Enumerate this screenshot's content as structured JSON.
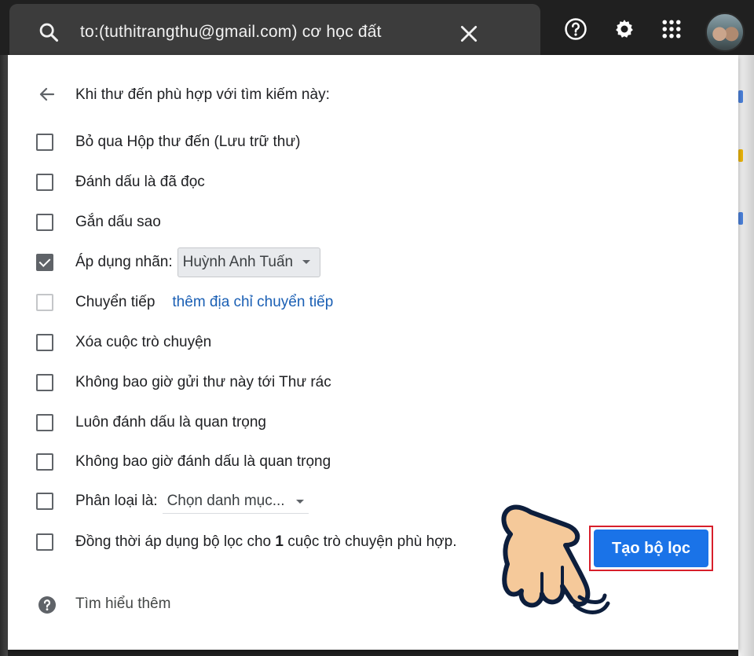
{
  "search": {
    "query": "to:(tuthitrangthu@gmail.com) cơ học đất",
    "icon": "search-icon",
    "clear_icon": "close-icon"
  },
  "topbar": {
    "icons": [
      "help-icon",
      "gear-icon",
      "apps-grid-icon",
      "avatar"
    ]
  },
  "filter": {
    "heading": "Khi thư đến phù hợp với tìm kiếm này:",
    "options": [
      {
        "label": "Bỏ qua Hộp thư đến (Lưu trữ thư)",
        "checked": false
      },
      {
        "label": "Đánh dấu là đã đọc",
        "checked": false
      },
      {
        "label": "Gắn dấu sao",
        "checked": false
      },
      {
        "label": "Áp dụng nhãn:",
        "checked": true,
        "select_value": "Huỳnh Anh Tuấn"
      },
      {
        "label": "Chuyển tiếp",
        "checked": false,
        "disabled": true,
        "link": "thêm địa chỉ chuyển tiếp"
      },
      {
        "label": "Xóa cuộc trò chuyện",
        "checked": false
      },
      {
        "label": "Không bao giờ gửi thư này tới Thư rác",
        "checked": false
      },
      {
        "label": "Luôn đánh dấu là quan trọng",
        "checked": false
      },
      {
        "label": "Không bao giờ đánh dấu là quan trọng",
        "checked": false
      },
      {
        "label": "Phân loại là:",
        "checked": false,
        "select_value": "Chọn danh mục..."
      },
      {
        "label_prefix": "Đồng thời áp dụng bộ lọc cho ",
        "label_count": "1",
        "label_suffix": " cuộc trò chuyện phù hợp.",
        "checked": false
      }
    ],
    "learn_more": "Tìm hiểu thêm",
    "create_button": "Tạo bộ lọc"
  },
  "colors": {
    "primary_button": "#1a73e8",
    "highlight_border": "#d71f2b",
    "link": "#1a5fb4"
  }
}
